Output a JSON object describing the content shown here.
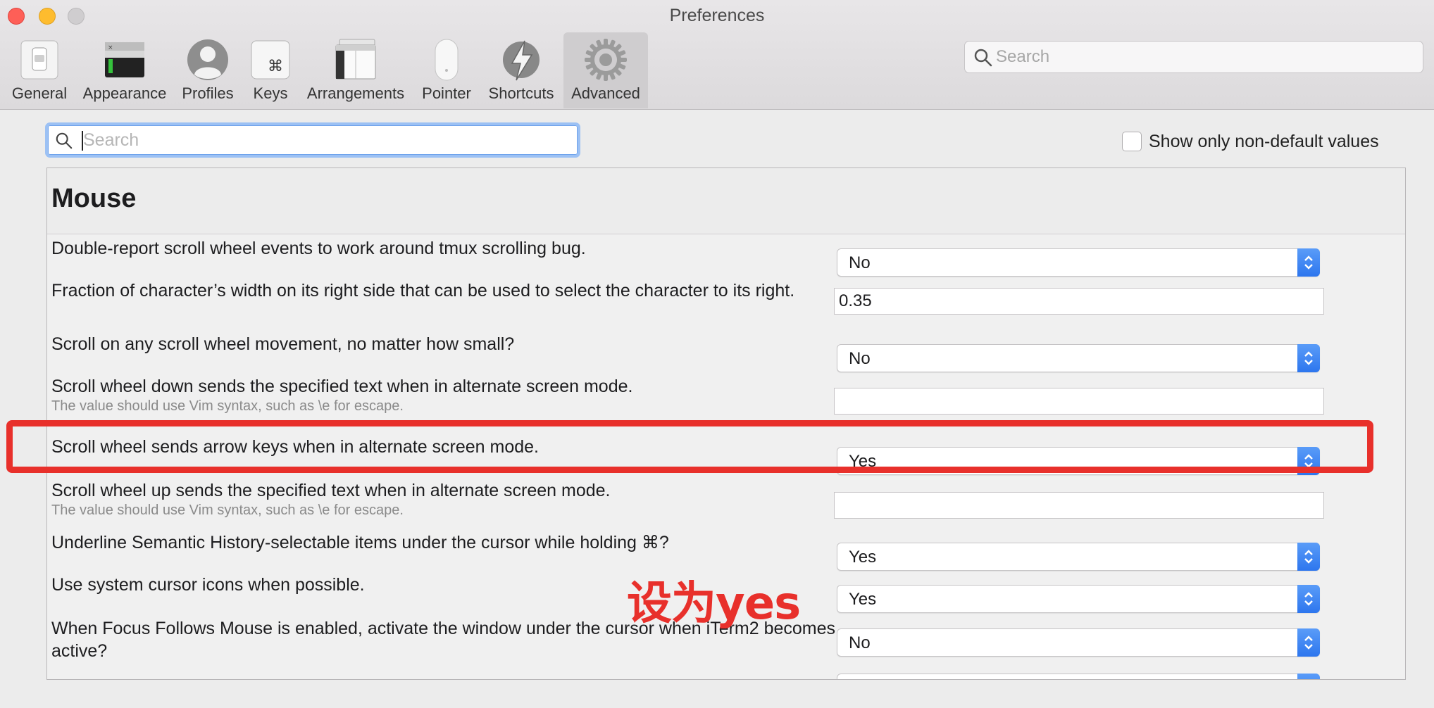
{
  "window": {
    "title": "Preferences"
  },
  "toolbar": {
    "tabs": [
      {
        "label": "General",
        "icon": "general-switch-icon"
      },
      {
        "label": "Appearance",
        "icon": "appearance-terminal-icon"
      },
      {
        "label": "Profiles",
        "icon": "profiles-user-icon"
      },
      {
        "label": "Keys",
        "icon": "keys-command-icon"
      },
      {
        "label": "Arrangements",
        "icon": "arrangements-windows-icon"
      },
      {
        "label": "Pointer",
        "icon": "pointer-mouse-icon"
      },
      {
        "label": "Shortcuts",
        "icon": "shortcuts-lightning-icon"
      },
      {
        "label": "Advanced",
        "icon": "advanced-gear-icon",
        "selected": true
      }
    ],
    "search_placeholder": "Search"
  },
  "filter": {
    "search_placeholder": "Search",
    "show_nondefault_label": "Show only non-default values",
    "show_nondefault_checked": false
  },
  "section": {
    "title": "Mouse"
  },
  "settings": [
    {
      "label": "Double-report scroll wheel events to work around tmux scrolling bug.",
      "control": "popup",
      "value": "No"
    },
    {
      "label": "Fraction of character’s width on its right side that can be used to select the character to its right.",
      "control": "text",
      "value": "0.35"
    },
    {
      "label": "Scroll on any scroll wheel movement, no matter how small?",
      "control": "popup",
      "value": "No"
    },
    {
      "label": "Scroll wheel down sends the specified text when in alternate screen mode.",
      "sub": "The value should use Vim syntax, such as \\e for escape.",
      "control": "text",
      "value": ""
    },
    {
      "label": "Scroll wheel sends arrow keys when in alternate screen mode.",
      "control": "popup",
      "value": "Yes"
    },
    {
      "label": "Scroll wheel up sends the specified text when in alternate screen mode.",
      "sub": "The value should use Vim syntax, such as \\e for escape.",
      "control": "text",
      "value": ""
    },
    {
      "label": "Underline Semantic History-selectable items under the cursor while holding ⌘?",
      "control": "popup",
      "value": "Yes"
    },
    {
      "label": "Use system cursor icons when possible.",
      "control": "popup",
      "value": "Yes"
    },
    {
      "label": "When Focus Follows Mouse is enabled, activate the window under the cursor when iTerm2 becomes active?",
      "control": "popup",
      "value": "No"
    }
  ],
  "annotation": {
    "text": "设为yes",
    "color": "#e8302b"
  },
  "colors": {
    "accent": "#2d76ee",
    "highlight": "#e8302b"
  }
}
